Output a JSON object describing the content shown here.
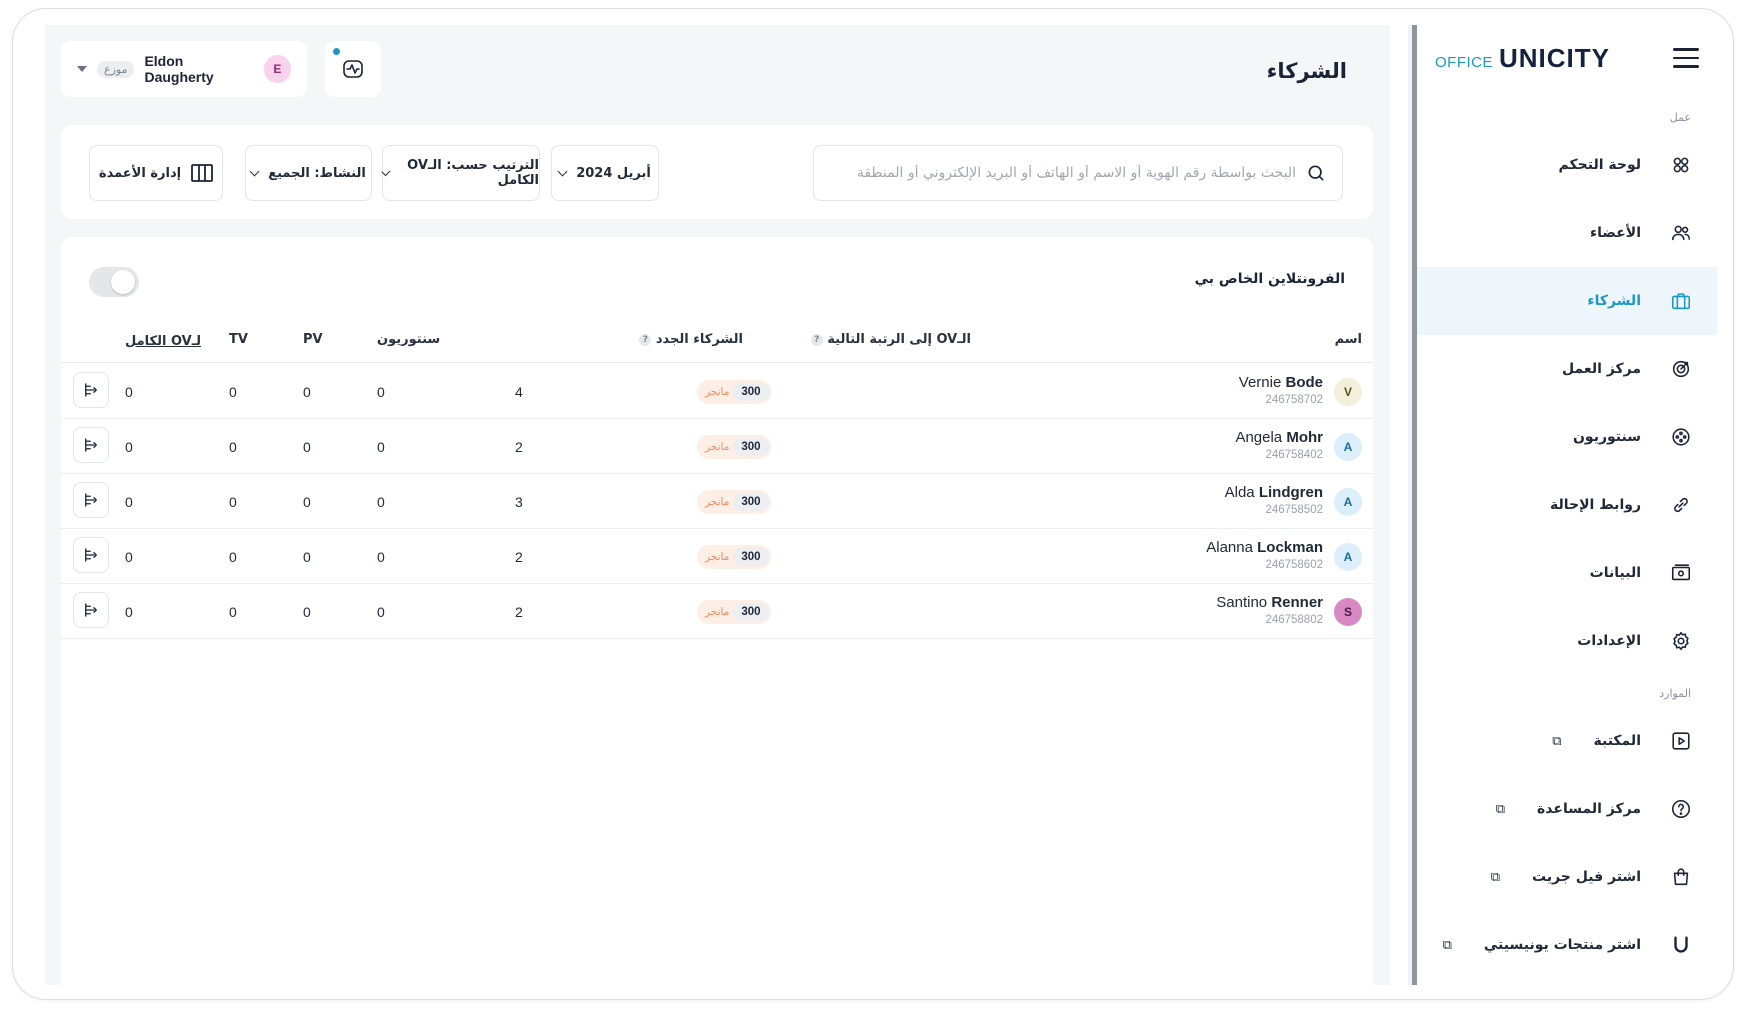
{
  "sidebar": {
    "brand_office": "OFFICE",
    "brand_unicity": "UNICITY",
    "section_work": "عمل",
    "section_resources": "الموارد",
    "items": [
      {
        "label": "لوحة التحكم",
        "icon": "dashboard-grid-icon"
      },
      {
        "label": "الأعضاء",
        "icon": "members-icon"
      },
      {
        "label": "الشركاء",
        "icon": "partners-briefcase-icon",
        "active": true
      },
      {
        "label": "مركز العمل",
        "icon": "target-icon"
      },
      {
        "label": "سنتوريون",
        "icon": "centurion-icon"
      },
      {
        "label": "روابط الإحالة",
        "icon": "link-icon"
      },
      {
        "label": "البيانات",
        "icon": "statements-icon"
      },
      {
        "label": "الإعدادات",
        "icon": "settings-gear-icon"
      }
    ],
    "resources": [
      {
        "label": "المكتبة",
        "icon": "library-play-icon",
        "external_glyph": "⧉"
      },
      {
        "label": "مركز المساعدة",
        "icon": "help-circle-icon",
        "external_glyph": "⧉"
      },
      {
        "label": "اشتر فيل جريت",
        "icon": "shopping-bag-icon",
        "external_glyph": "⧉"
      },
      {
        "label": "اشتر منتجات يونيسيتي",
        "icon": "unicity-u-icon",
        "external_glyph": "⧉"
      }
    ]
  },
  "header": {
    "title": "الشركاء",
    "user": {
      "name": "Eldon Daugherty",
      "initial": "E",
      "role": "موزع",
      "avatar_color": "#f9d3ec",
      "avatar_text_color": "#9c2a77"
    }
  },
  "filters": {
    "search_placeholder": "البحث بواسطة رقم الهوية أو الاسم أو الهاتف أو البريد الإلكتروني أو المنطقة",
    "period": "أبريل 2024",
    "sort": "الترتيب حسب: الـOV الكامل",
    "activity": "النشاط: الجميع",
    "columns": "إدارة الأعمدة"
  },
  "table": {
    "title": "الفرونتلاين الخاص بي",
    "headers": {
      "name": "اسم",
      "ov_next_rank": "الـOV إلى الرتبة التالية",
      "new_partners": "الشركاء الجدد",
      "centurion": "سنتوريون",
      "pv": "PV",
      "tv": "TV",
      "full_ov": "الـOV الكامل"
    },
    "rows": [
      {
        "first": "Vernie",
        "last": "Bode",
        "id": "246758702",
        "initial": "V",
        "avatar_bg": "#f1efd9",
        "avatar_fg": "#5a5524",
        "ov_value": "300",
        "ov_rank": "مانجر",
        "new_partners": "4",
        "centurion": "0",
        "pv": "0",
        "tv": "0",
        "full_ov": "0"
      },
      {
        "first": "Angela",
        "last": "Mohr",
        "id": "246758402",
        "initial": "A",
        "avatar_bg": "#dbeefa",
        "avatar_fg": "#1d6e9c",
        "ov_value": "300",
        "ov_rank": "مانجر",
        "new_partners": "2",
        "centurion": "0",
        "pv": "0",
        "tv": "0",
        "full_ov": "0"
      },
      {
        "first": "Alda",
        "last": "Lindgren",
        "id": "246758502",
        "initial": "A",
        "avatar_bg": "#dbeefa",
        "avatar_fg": "#1d6e9c",
        "ov_value": "300",
        "ov_rank": "مانجر",
        "new_partners": "3",
        "centurion": "0",
        "pv": "0",
        "tv": "0",
        "full_ov": "0"
      },
      {
        "first": "Alanna",
        "last": "Lockman",
        "id": "246758602",
        "initial": "A",
        "avatar_bg": "#dbeefa",
        "avatar_fg": "#1d6e9c",
        "ov_value": "300",
        "ov_rank": "مانجر",
        "new_partners": "2",
        "centurion": "0",
        "pv": "0",
        "tv": "0",
        "full_ov": "0"
      },
      {
        "first": "Santino",
        "last": "Renner",
        "id": "246758802",
        "initial": "S",
        "avatar_bg": "#d889c4",
        "avatar_fg": "#4a1a3d",
        "ov_value": "300",
        "ov_rank": "مانجر",
        "new_partners": "2",
        "centurion": "0",
        "pv": "0",
        "tv": "0",
        "full_ov": "0"
      }
    ]
  },
  "colors": {
    "accent": "#1b98c8",
    "rank_pill": "#fdeee6",
    "rank_text": "#f08a5d"
  }
}
